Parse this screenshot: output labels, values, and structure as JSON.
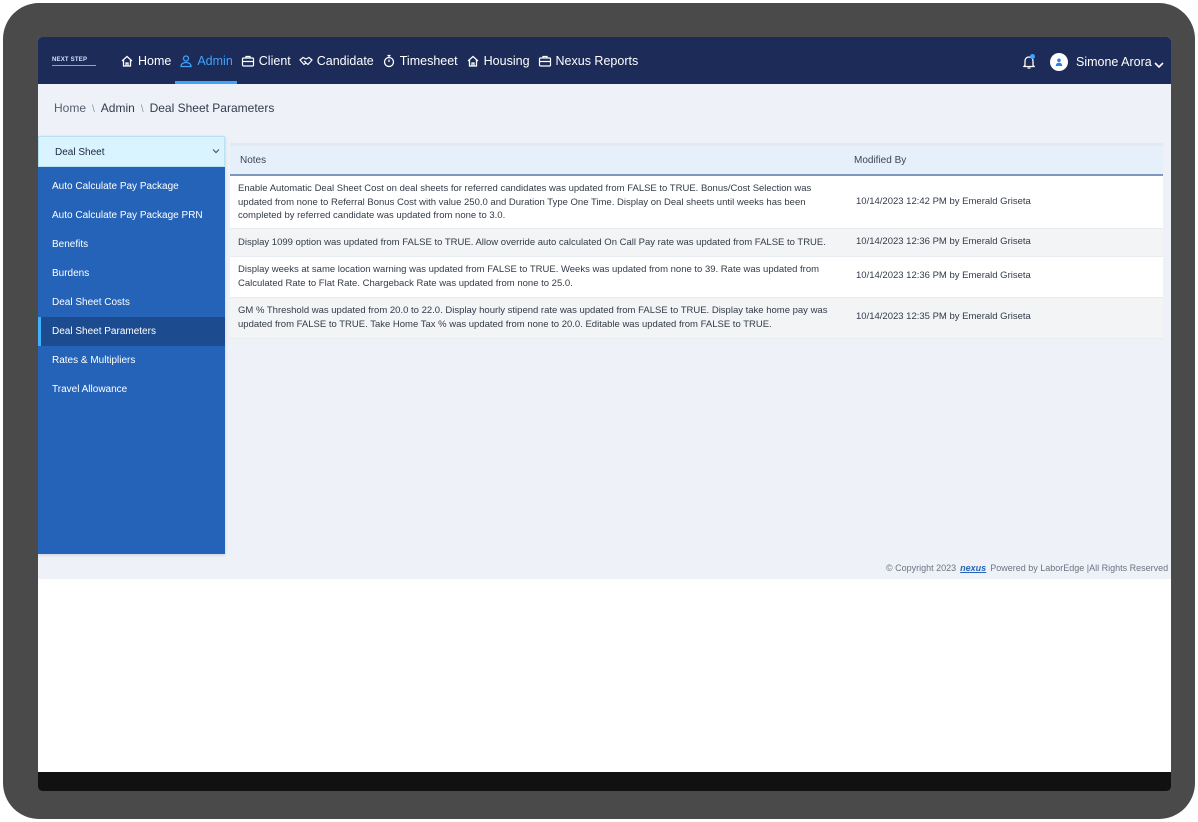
{
  "brand": {
    "logo_text": "NEXT STEP"
  },
  "nav": {
    "items": [
      {
        "label": "Home",
        "icon": "home-icon"
      },
      {
        "label": "Admin",
        "icon": "user-icon",
        "active": true
      },
      {
        "label": "Client",
        "icon": "briefcase-icon"
      },
      {
        "label": "Candidate",
        "icon": "handshake-icon"
      },
      {
        "label": "Timesheet",
        "icon": "stopwatch-icon"
      },
      {
        "label": "Housing",
        "icon": "home-icon"
      },
      {
        "label": "Nexus Reports",
        "icon": "briefcase-icon"
      }
    ],
    "accent_color": "#3fa2ff",
    "background_color": "#1c2b57"
  },
  "user": {
    "name": "Simone Arora"
  },
  "breadcrumb": {
    "items": [
      "Home",
      "Admin",
      "Deal Sheet Parameters"
    ]
  },
  "sidebar": {
    "selector": {
      "selected": "Deal Sheet"
    },
    "items": [
      {
        "label": "Auto Calculate Pay Package"
      },
      {
        "label": "Auto Calculate Pay Package PRN"
      },
      {
        "label": "Benefits"
      },
      {
        "label": "Burdens"
      },
      {
        "label": "Deal Sheet Costs"
      },
      {
        "label": "Deal Sheet Parameters",
        "active": true
      },
      {
        "label": "Rates & Multipliers"
      },
      {
        "label": "Travel Allowance"
      }
    ],
    "background_color": "#2563b8"
  },
  "table": {
    "headers": {
      "notes": "Notes",
      "modified_by": "Modified By"
    },
    "rows": [
      {
        "note": "Enable Automatic Deal Sheet Cost on deal sheets for referred candidates was updated from FALSE to TRUE. Bonus/Cost Selection was updated from none to Referral Bonus Cost with value 250.0 and Duration Type One Time. Display on Deal sheets until weeks has been completed by referred candidate was updated from none to 3.0.",
        "modified_by": "10/14/2023 12:42 PM by Emerald Griseta"
      },
      {
        "note": "Display 1099 option was updated from FALSE to TRUE. Allow override auto calculated On Call Pay rate was updated from FALSE to TRUE.",
        "modified_by": "10/14/2023 12:36 PM by Emerald Griseta"
      },
      {
        "note": "Display weeks at same location warning was updated from FALSE to TRUE. Weeks was updated from none to 39. Rate was updated from Calculated Rate to Flat Rate. Chargeback Rate was updated from none to 25.0.",
        "modified_by": "10/14/2023 12:36 PM by Emerald Griseta"
      },
      {
        "note": "GM % Threshold was updated from 20.0 to 22.0. Display hourly stipend rate was updated from FALSE to TRUE. Display take home pay was updated from FALSE to TRUE. Take Home Tax % was updated from none to 20.0. Editable was updated from FALSE to TRUE.",
        "modified_by": "10/14/2023 12:35 PM by Emerald Griseta"
      }
    ]
  },
  "footer": {
    "copyright": "© Copyright 2023",
    "brand": "nexus",
    "powered": "Powered by LaborEdge |All Rights Reserved"
  }
}
